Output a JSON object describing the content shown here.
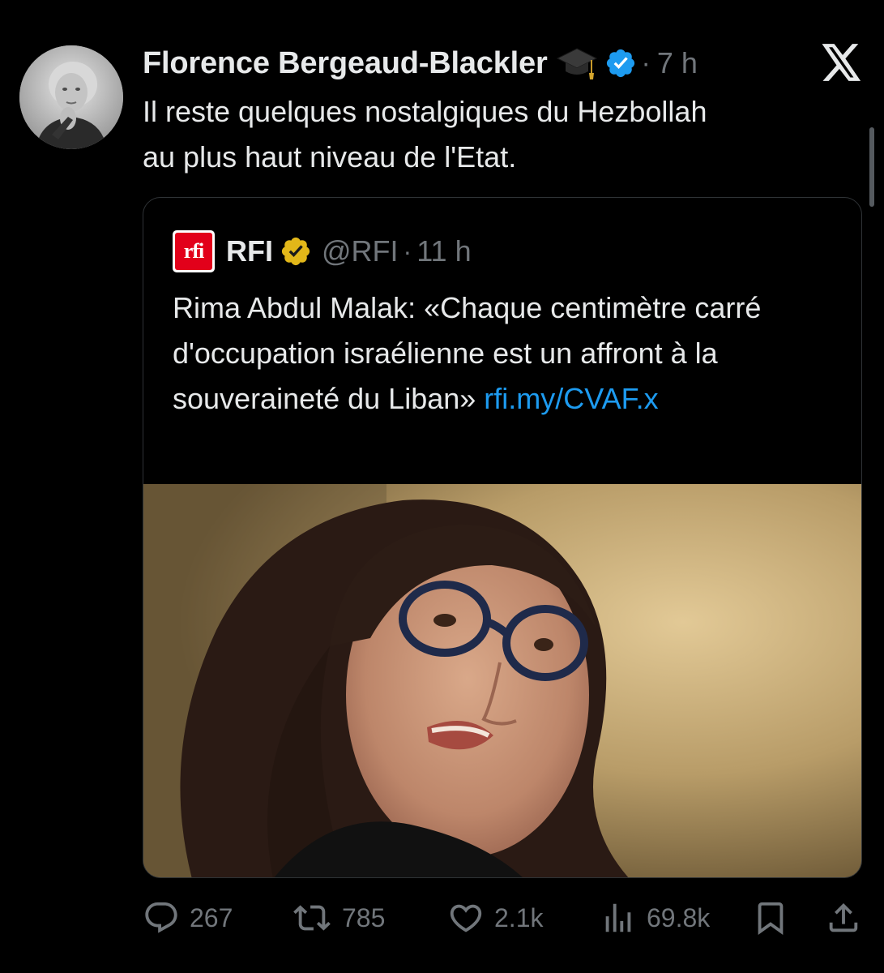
{
  "post": {
    "author_name": "Florence Bergeaud-Blackler",
    "time": "7 h",
    "separator": "·",
    "text": "Il reste quelques nostalgiques du Hezbollah\nau plus haut niveau de l'Etat."
  },
  "quote": {
    "name": "RFI",
    "logo_text": "rfi",
    "handle": "@RFI",
    "separator": "·",
    "time": "11 h",
    "text": "Rima Abdul Malak: «Chaque centimètre carré d'occupation israélienne est un affront à la souveraineté du Liban» ",
    "link_text": "rfi.my/CVAF.x"
  },
  "actions": {
    "replies": "267",
    "reposts": "785",
    "likes": "2.1k",
    "views": "69.8k"
  },
  "icons": {
    "avatar": "avatar",
    "graduation": "graduation-cap-icon",
    "verified": "verified-badge-icon",
    "x_logo": "x-logo-icon",
    "gold_check": "gold-verified-badge-icon",
    "reply": "reply-icon",
    "repost": "repost-icon",
    "like": "like-icon",
    "views": "views-icon",
    "bookmark": "bookmark-icon",
    "share": "share-icon"
  },
  "colors": {
    "background": "#000000",
    "text": "#e7e9ea",
    "muted": "#71767b",
    "link": "#1d9bf0",
    "verified_blue": "#1d9bf0",
    "verified_gold": "#e2b719",
    "rfi_red": "#e2001a"
  }
}
